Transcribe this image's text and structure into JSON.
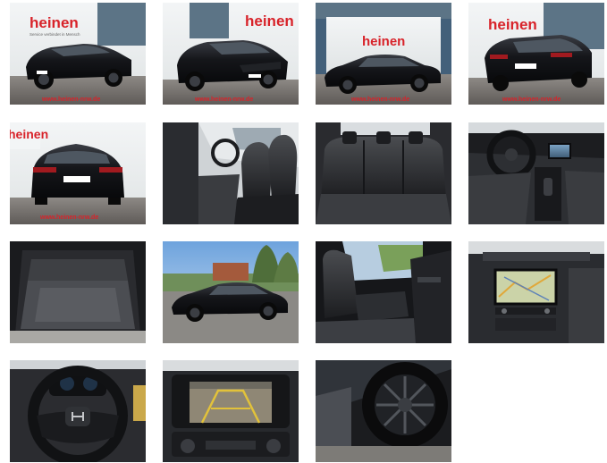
{
  "gallery": {
    "brand_logo": "heinen",
    "brand_tagline": "Service verbindet in Mensch",
    "website": "www.heinen-nrw.de",
    "colors": {
      "brand_red": "#d8232a",
      "car_black": "#141518",
      "wall_white": "#eef0f0",
      "glass_blue": "#5c7486",
      "asphalt": "#6f6f6f",
      "interior_dark": "#1c1d20"
    },
    "images": [
      {
        "name": "front-left-exterior",
        "icon": "car-front-icon"
      },
      {
        "name": "front-left-exterior-2",
        "icon": "car-front-icon"
      },
      {
        "name": "side-exterior",
        "icon": "car-side-icon"
      },
      {
        "name": "rear-right-exterior",
        "icon": "car-rear-icon"
      },
      {
        "name": "rear-exterior",
        "icon": "car-rear-icon"
      },
      {
        "name": "front-seats-interior",
        "icon": "seat-icon"
      },
      {
        "name": "rear-seats-interior",
        "icon": "seat-icon"
      },
      {
        "name": "cockpit-interior",
        "icon": "steering-wheel-icon"
      },
      {
        "name": "trunk-interior",
        "icon": "trunk-icon"
      },
      {
        "name": "side-outdoor-exterior",
        "icon": "car-side-icon"
      },
      {
        "name": "open-door-interior",
        "icon": "door-icon"
      },
      {
        "name": "navigation-display",
        "icon": "map-icon"
      },
      {
        "name": "steering-wheel",
        "icon": "steering-wheel-icon"
      },
      {
        "name": "rear-camera-display",
        "icon": "camera-icon"
      },
      {
        "name": "alloy-wheel",
        "icon": "wheel-icon"
      }
    ]
  }
}
